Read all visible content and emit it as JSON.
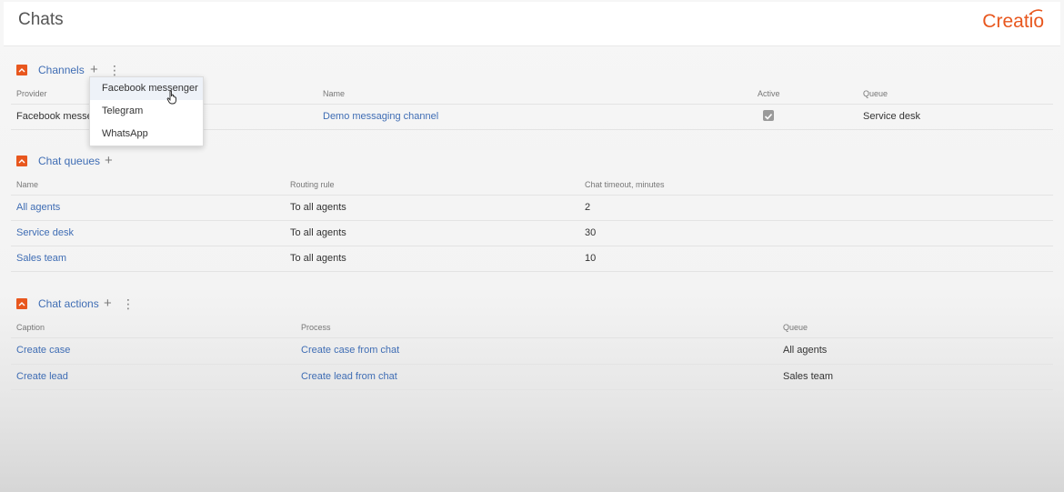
{
  "header": {
    "title": "Chats",
    "logo_text": "Creatio"
  },
  "colors": {
    "accent": "#e8571e",
    "link": "#3f6db4"
  },
  "channels": {
    "title": "Channels",
    "columns": [
      "Provider",
      "Name",
      "Active",
      "Queue"
    ],
    "rows": [
      {
        "provider": "Facebook messenger",
        "name": "Demo messaging channel",
        "active": true,
        "queue": "Service desk"
      }
    ],
    "dropdown": {
      "items": [
        "Facebook messenger",
        "Telegram",
        "WhatsApp"
      ],
      "hovered": "Facebook messenger"
    }
  },
  "queues": {
    "title": "Chat queues",
    "columns": [
      "Name",
      "Routing rule",
      "Chat timeout, minutes"
    ],
    "rows": [
      {
        "name": "All agents",
        "rule": "To all agents",
        "timeout": "2"
      },
      {
        "name": "Service desk",
        "rule": "To all agents",
        "timeout": "30"
      },
      {
        "name": "Sales team",
        "rule": "To all agents",
        "timeout": "10"
      }
    ]
  },
  "actions": {
    "title": "Chat actions",
    "columns": [
      "Caption",
      "Process",
      "Queue"
    ],
    "rows": [
      {
        "caption": "Create case",
        "process": "Create case from chat",
        "queue": "All agents"
      },
      {
        "caption": "Create lead",
        "process": "Create lead from chat",
        "queue": "Sales team"
      }
    ]
  }
}
